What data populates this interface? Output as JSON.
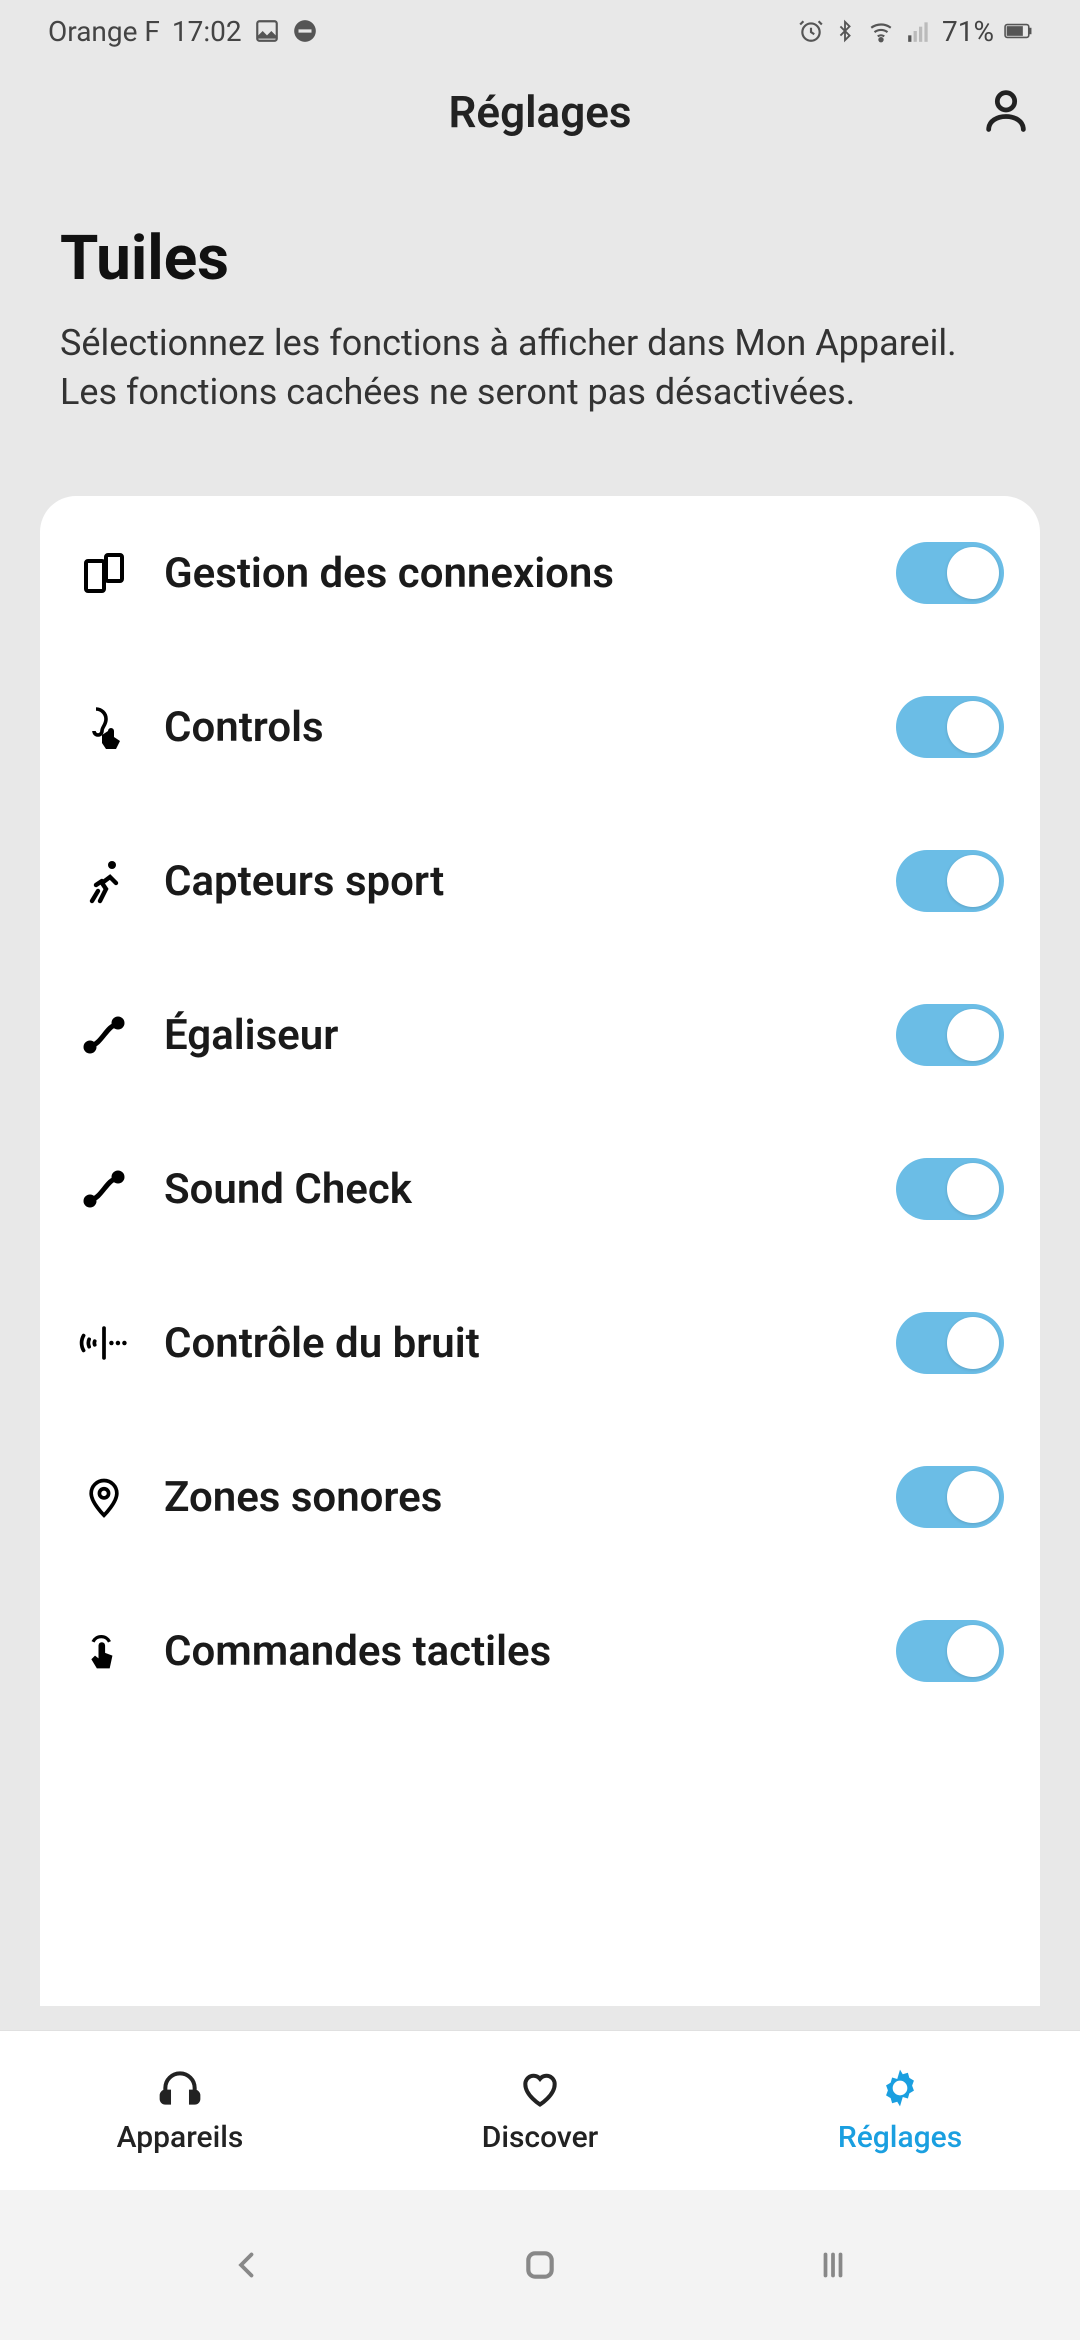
{
  "status": {
    "carrier": "Orange F",
    "time": "17:02",
    "battery": "71%"
  },
  "header": {
    "title": "Réglages"
  },
  "intro": {
    "title": "Tuiles",
    "description": "Sélectionnez les fonctions à afficher dans Mon Appareil. Les fonctions cachées ne seront pas désactivées."
  },
  "tiles": [
    {
      "icon": "devices-icon",
      "label": "Gestion des connexions",
      "on": true
    },
    {
      "icon": "ear-touch-icon",
      "label": "Controls",
      "on": true
    },
    {
      "icon": "runner-icon",
      "label": "Capteurs sport",
      "on": true
    },
    {
      "icon": "curve-icon",
      "label": "Égaliseur",
      "on": true
    },
    {
      "icon": "curve-icon",
      "label": "Sound Check",
      "on": true
    },
    {
      "icon": "anc-icon",
      "label": "Contrôle du bruit",
      "on": true
    },
    {
      "icon": "pin-icon",
      "label": "Zones sonores",
      "on": true
    },
    {
      "icon": "tap-icon",
      "label": "Commandes tactiles",
      "on": true
    }
  ],
  "nav": {
    "items": [
      {
        "icon": "headphones-icon",
        "label": "Appareils",
        "active": false
      },
      {
        "icon": "heart-icon",
        "label": "Discover",
        "active": false
      },
      {
        "icon": "gear-icon",
        "label": "Réglages",
        "active": true
      }
    ]
  },
  "colors": {
    "accent": "#1a9fe0",
    "toggle": "#6bbde6"
  }
}
